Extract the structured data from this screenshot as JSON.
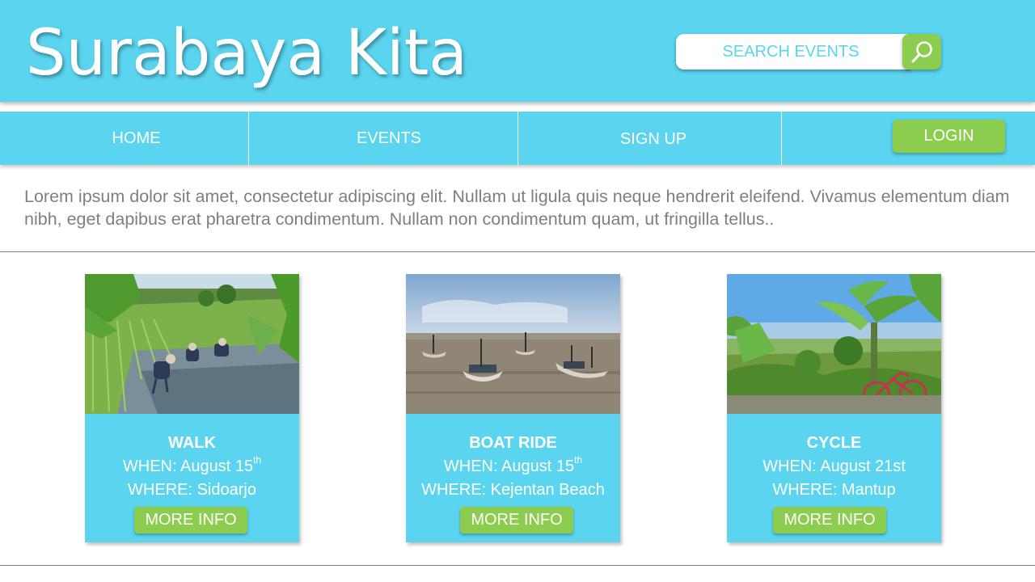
{
  "header": {
    "site_title": "Surabaya Kita",
    "search_placeholder": "SEARCH EVENTS",
    "search_icon": "search-icon"
  },
  "nav": {
    "home": "HOME",
    "events": "EVENTS",
    "sign_up": "SIGN UP",
    "login": "LOGIN"
  },
  "intro": "Lorem ipsum dolor sit amet, consectetur adipiscing elit. Nullam ut ligula quis neque hendrerit eleifend. Vivamus elementum diam nibh, eget dapibus erat pharetra condimentum. Nullam non condimentum quam, ut fringilla tellus..",
  "events": [
    {
      "title": "WALK",
      "when_label": "WHEN: August 15",
      "when_suffix": "th",
      "where": "WHERE: Sidoarjo",
      "button": "MORE INFO"
    },
    {
      "title": "BOAT RIDE",
      "when_label": "WHEN: August 15",
      "when_suffix": "th",
      "where": "WHERE: Kejentan Beach",
      "button": "MORE INFO"
    },
    {
      "title": "CYCLE",
      "when_label": "WHEN: August 21st",
      "when_suffix": "",
      "where": "WHERE: Mantup",
      "button": "MORE INFO"
    }
  ],
  "colors": {
    "primary": "#5ad4ef",
    "accent": "#8ccc4e",
    "text_muted": "#7f7f7f"
  }
}
